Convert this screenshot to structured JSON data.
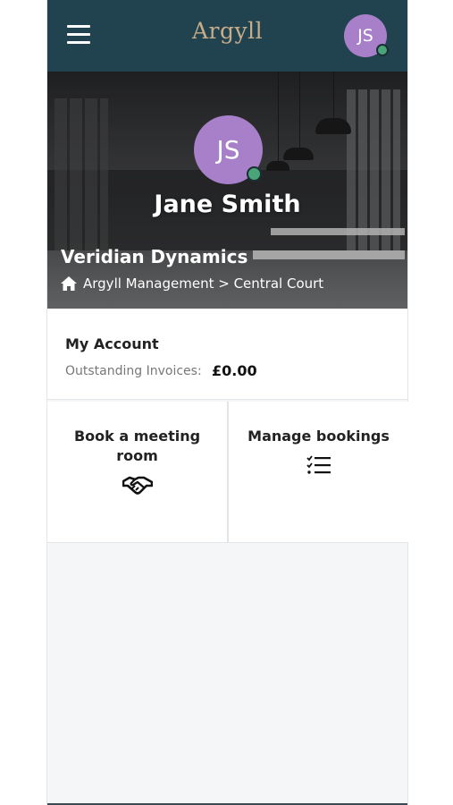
{
  "header": {
    "brand": "Argyll",
    "avatar_initials": "JS",
    "brand_color": "#c7ad8a",
    "bar_color": "#21424f"
  },
  "profile": {
    "initials": "JS",
    "name": "Jane Smith",
    "company": "Veridian Dynamics",
    "location": "Argyll Management > Central Court",
    "avatar_color": "#a780c9",
    "status_color": "#4aa479"
  },
  "account": {
    "title": "My Account",
    "invoices_label": "Outstanding Invoices:",
    "invoices_value": "£0.00"
  },
  "tiles": [
    {
      "label": "Book a meeting room",
      "icon": "handshake-icon"
    },
    {
      "label": "Manage bookings",
      "icon": "checklist-icon"
    }
  ]
}
